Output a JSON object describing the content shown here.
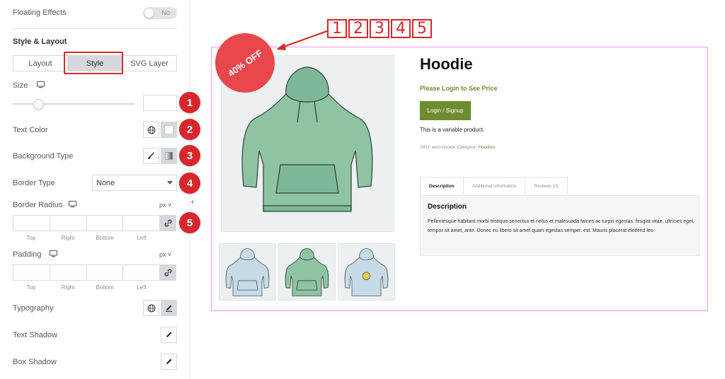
{
  "panel": {
    "floating_effects": {
      "label": "Floating Effects",
      "toggle": "No"
    },
    "section_title": "Style & Layout",
    "tabs": [
      {
        "label": "Layout"
      },
      {
        "label": "Style"
      },
      {
        "label": "SVG Layer"
      }
    ],
    "active_tab": "Style",
    "size": {
      "label": "Size",
      "icon": "desktop-icon",
      "value": ""
    },
    "text_color": {
      "label": "Text Color"
    },
    "background_type": {
      "label": "Background Type"
    },
    "border_type": {
      "label": "Border Type",
      "value": "None"
    },
    "border_radius": {
      "label": "Border Radius",
      "unit": "px",
      "sub_labels": [
        "Top",
        "Right",
        "Bottom",
        "Left"
      ]
    },
    "padding": {
      "label": "Padding",
      "unit": "px",
      "sub_labels": [
        "Top",
        "Right",
        "Bottom",
        "Left"
      ]
    },
    "typography": {
      "label": "Typography"
    },
    "text_shadow": {
      "label": "Text Shadow"
    },
    "box_shadow": {
      "label": "Box Shadow"
    }
  },
  "callouts": [
    "1",
    "2",
    "3",
    "4",
    "5"
  ],
  "callout_row": [
    "1",
    "2",
    "3",
    "4",
    "5"
  ],
  "product": {
    "sale_badge": "40% OFF",
    "title": "Hoodie",
    "login_note": "Please Login to See Price",
    "login_button": "Login / Signup",
    "short_description": "This is a variable product.",
    "meta_prefix": "SKU: woo-hoodie Category:",
    "meta_category": "Hoodies",
    "tabs": [
      "Description",
      "Additional information",
      "Reviews (0)"
    ],
    "description_heading": "Description",
    "description_body": "Pellentesque habitant morbi tristique senectus et netus et malesuada fames ac turpis egestas. feugiat vitae, ultricies eget, tempor sit amet, ante. Donec eu libero sit amet quam egestas semper. est. Mauris placerat eleifend leo."
  },
  "colors": {
    "accent_red": "#d7272b",
    "sale_red": "#e8484b",
    "olive_green": "#6d8c2e",
    "hoodie_green": "#8fc4a3",
    "hoodie_blue": "#c7dbe6",
    "preview_border": "#e59be6"
  }
}
